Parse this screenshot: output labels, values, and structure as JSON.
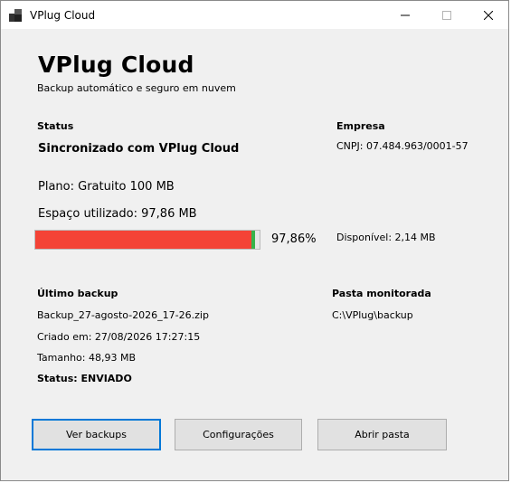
{
  "window": {
    "title": "VPlug Cloud"
  },
  "header": {
    "title": "VPlug Cloud",
    "subtitle": "Backup automático e seguro em nuvem"
  },
  "status": {
    "label": "Status",
    "value": "Sincronizado com VPlug Cloud",
    "plan": "Plano: Gratuito 100 MB",
    "used": "Espaço utilizado: 97,86 MB",
    "percent_text": "97,86%",
    "usage_fraction": 0.9786,
    "available": "Disponível: 2,14 MB"
  },
  "company": {
    "label": "Empresa",
    "cnpj": "CNPJ: 07.484.963/0001-57"
  },
  "last_backup": {
    "label": "Último backup",
    "file": "Backup_27-agosto-2026_17-26.zip",
    "created": "Criado em: 27/08/2026 17:27:15",
    "size": "Tamanho: 48,93 MB",
    "status": "Status: ENVIADO"
  },
  "monitored": {
    "label": "Pasta monitorada",
    "path": "C:\\VPlug\\backup"
  },
  "buttons": {
    "view_backups": "Ver backups",
    "settings": "Configurações",
    "open_folder": "Abrir pasta"
  },
  "colors": {
    "progress_fill": "#f44336",
    "progress_tip": "#36b34a",
    "focus_border": "#0078d7"
  }
}
